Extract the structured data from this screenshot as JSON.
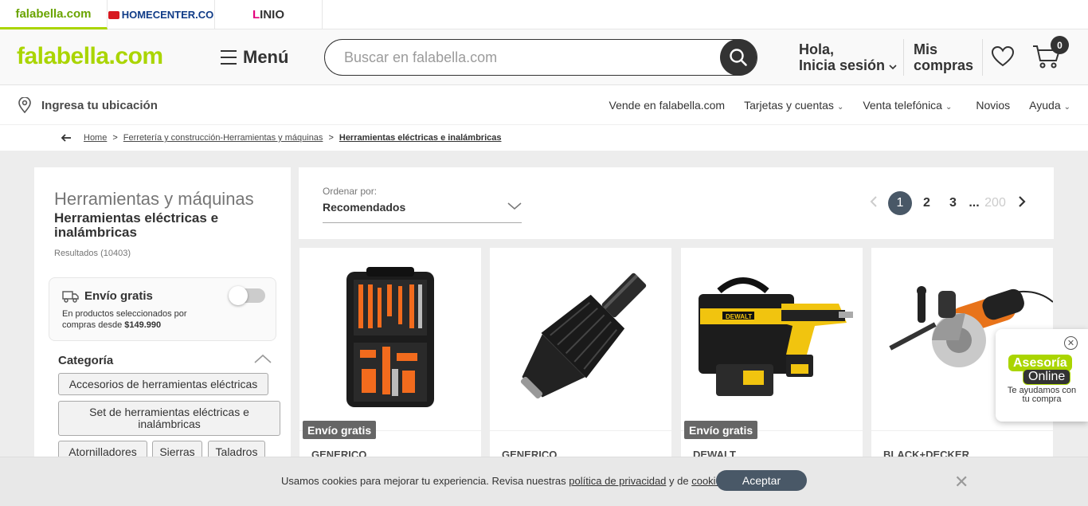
{
  "brandbar": {
    "falabella": "falabella.com",
    "homecenter": "HOMECENTER.CO",
    "linio_l": "L",
    "linio_rest": "INIO"
  },
  "header": {
    "logo": "falabella.com",
    "menu_label": "Menú",
    "search_placeholder": "Buscar en falabella.com",
    "login_line1": "Hola,",
    "login_line2": "Inicia sesión",
    "orders_line1": "Mis",
    "orders_line2": "compras",
    "cart_count": "0"
  },
  "subheader": {
    "location": "Ingresa tu ubicación",
    "links": [
      {
        "label": "Vende en falabella.com",
        "chevron": false
      },
      {
        "label": "Tarjetas y cuentas",
        "chevron": true
      },
      {
        "label": "Venta telefónica",
        "chevron": true
      },
      {
        "label": "Novios",
        "chevron": false
      },
      {
        "label": "Ayuda",
        "chevron": true
      }
    ]
  },
  "breadcrumb": {
    "home": "Home",
    "sep": ">",
    "level1": "Ferretería y construcción-Herramientas y máquinas",
    "current": "Herramientas eléctricas e inalámbricas"
  },
  "sidebar": {
    "category_title": "Herramientas y máquinas",
    "subcategory_title": "Herramientas eléctricas e inalámbricas",
    "results": "Resultados (10403)",
    "envio_title": "Envío gratis",
    "envio_desc_prefix": "En productos seleccionados por compras desde ",
    "envio_desc_amount": "$149.990",
    "categoria_heading": "Categoría",
    "chips": [
      "Accesorios de herramientas eléctricas",
      "Set de herramientas eléctricas e inalámbricas",
      "Atornilladores",
      "Sierras",
      "Taladros"
    ]
  },
  "sort": {
    "label": "Ordenar por:",
    "value": "Recomendados"
  },
  "pagination": {
    "current": "1",
    "pages": [
      "2",
      "3"
    ],
    "ellipsis": "...",
    "last": "200"
  },
  "products": [
    {
      "brand": "GENERICO",
      "badge": "Envío gratis"
    },
    {
      "brand": "GENERICO",
      "badge": ""
    },
    {
      "brand": "DEWALT",
      "badge": "Envío gratis"
    },
    {
      "brand": "BLACK+DECKER",
      "badge": ""
    }
  ],
  "chat": {
    "line1": "Asesoría",
    "line2": "Online",
    "caption": "Te ayudamos con tu compra"
  },
  "cookies": {
    "text_before": "Usamos cookies para mejorar tu experiencia. Revisa nuestras ",
    "privacy_link": "política de privacidad",
    "text_mid": " y de ",
    "cookies_link": "cookies",
    "text_end": ".",
    "accept": "Aceptar"
  },
  "colors": {
    "brand_green": "#aad500",
    "dark": "#333333",
    "pager_active": "#495867",
    "badge": "#666666"
  }
}
